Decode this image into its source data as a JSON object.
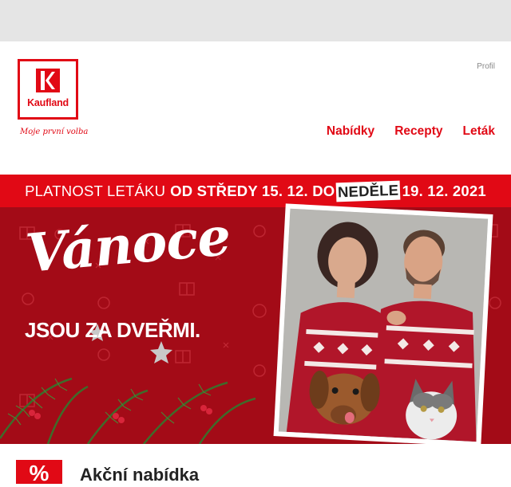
{
  "brand": {
    "name": "Kaufland",
    "slogan": "Moje první volba",
    "color": "#e10915"
  },
  "header": {
    "profile_link": "Profil",
    "nav": [
      {
        "label": "Nabídky"
      },
      {
        "label": "Recepty"
      },
      {
        "label": "Leták"
      }
    ]
  },
  "banner": {
    "validity_prefix": "PLATNOST LETÁKU",
    "validity_from": "OD STŘEDY 15. 12. DO",
    "validity_day_highlight": "NEDĚLE",
    "validity_to": "19. 12. 2021",
    "headline": "Vánoce",
    "subheadline": "JSOU ZA DVEŘMI."
  },
  "offer": {
    "icon": "percent-icon",
    "icon_text": "%",
    "title": "Akční nabídka"
  }
}
